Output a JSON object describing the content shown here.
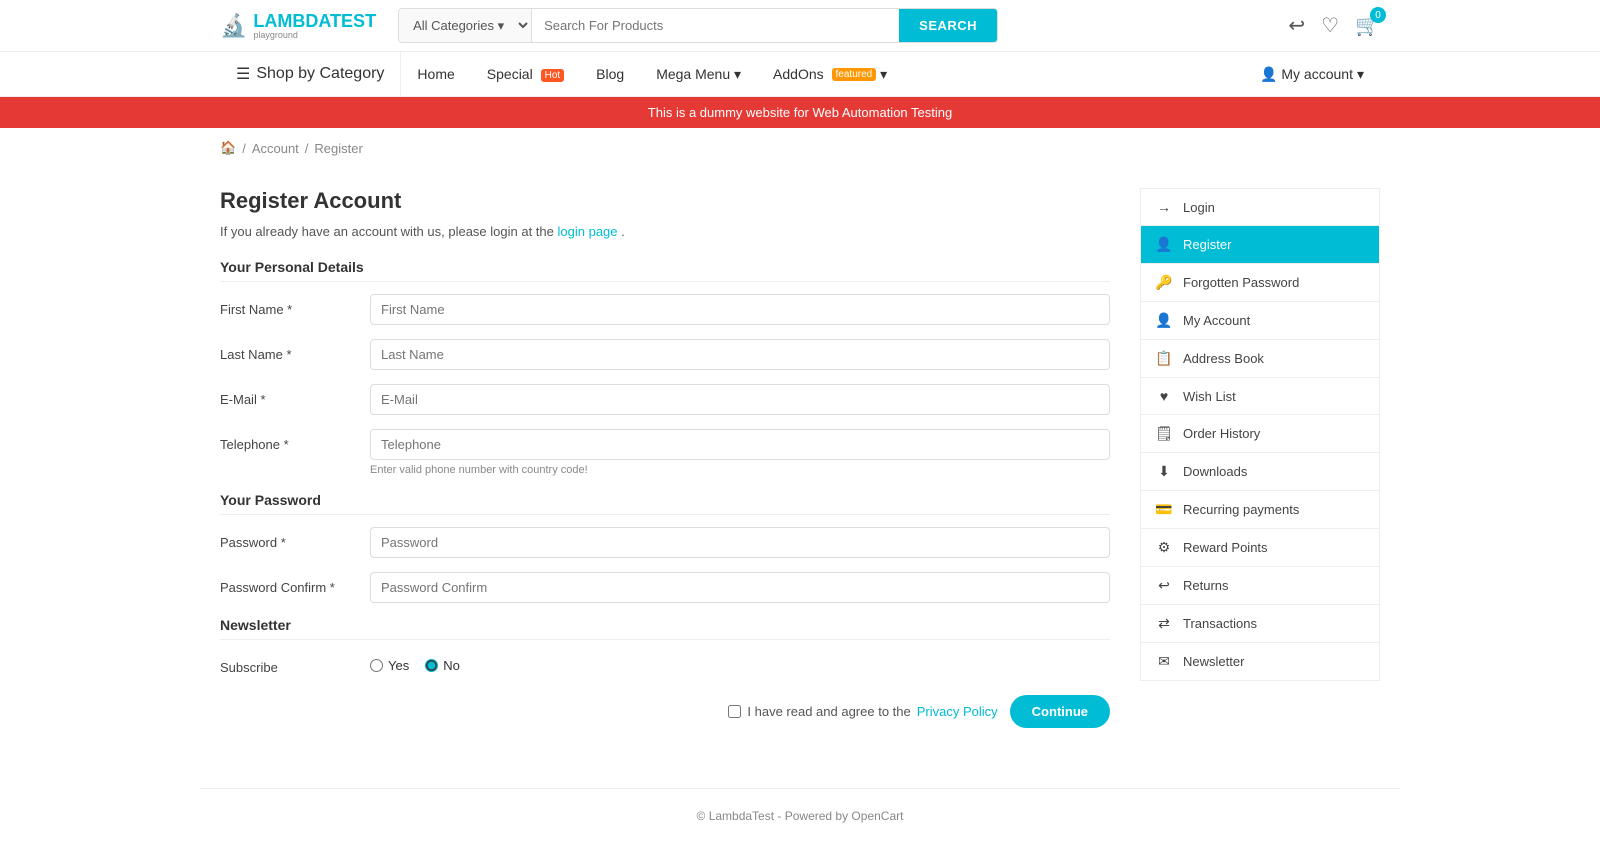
{
  "header": {
    "logo_icon": "🔬",
    "logo_name": "LAMBDATEST",
    "logo_sub": "playground",
    "search_placeholder": "Search For Products",
    "search_btn": "SEARCH",
    "category_default": "All Categories",
    "back_icon": "↩",
    "wishlist_icon": "♡",
    "cart_icon": "🛒",
    "cart_count": "0"
  },
  "nav": {
    "category_icon": "☰",
    "shop_by_category": "Shop by Category",
    "home": "Home",
    "special": "Special",
    "special_badge": "Hot",
    "blog": "Blog",
    "mega_menu": "Mega Menu",
    "addons": "AddOns",
    "featured_badge": "featured",
    "my_account": "My account"
  },
  "alert": {
    "text": "This is a dummy website for Web Automation Testing"
  },
  "breadcrumb": {
    "home_icon": "🏠",
    "account": "Account",
    "register": "Register"
  },
  "form": {
    "title": "Register Account",
    "login_prompt_pre": "If you already have an account with us, please login at the",
    "login_link": "login page",
    "login_prompt_post": ".",
    "personal_details_label": "Your Personal Details",
    "first_name_label": "First Name *",
    "first_name_placeholder": "First Name",
    "last_name_label": "Last Name *",
    "last_name_placeholder": "Last Name",
    "email_label": "E-Mail *",
    "email_placeholder": "E-Mail",
    "telephone_label": "Telephone *",
    "telephone_placeholder": "Telephone",
    "telephone_hint": "Enter valid phone number with country code!",
    "password_section_label": "Your Password",
    "password_label": "Password *",
    "password_placeholder": "Password",
    "password_confirm_label": "Password Confirm *",
    "password_confirm_placeholder": "Password Confirm",
    "newsletter_label": "Newsletter",
    "subscribe_label": "Subscribe",
    "yes_label": "Yes",
    "no_label": "No",
    "agree_text": "I have read and agree to the",
    "privacy_link": "Privacy Policy",
    "continue_btn": "Continue"
  },
  "sidebar": {
    "items": [
      {
        "label": "Login",
        "icon": "→",
        "active": false
      },
      {
        "label": "Register",
        "icon": "👤",
        "active": true
      },
      {
        "label": "Forgotten Password",
        "icon": "🔑",
        "active": false
      },
      {
        "label": "My Account",
        "icon": "👤",
        "active": false
      },
      {
        "label": "Address Book",
        "icon": "📋",
        "active": false
      },
      {
        "label": "Wish List",
        "icon": "♥",
        "active": false
      },
      {
        "label": "Order History",
        "icon": "🗒",
        "active": false
      },
      {
        "label": "Downloads",
        "icon": "⬇",
        "active": false
      },
      {
        "label": "Recurring payments",
        "icon": "💳",
        "active": false
      },
      {
        "label": "Reward Points",
        "icon": "⚙",
        "active": false
      },
      {
        "label": "Returns",
        "icon": "↩",
        "active": false
      },
      {
        "label": "Transactions",
        "icon": "⇄",
        "active": false
      },
      {
        "label": "Newsletter",
        "icon": "✉",
        "active": false
      }
    ]
  },
  "footer": {
    "text": "© LambdaTest - Powered by OpenCart"
  }
}
